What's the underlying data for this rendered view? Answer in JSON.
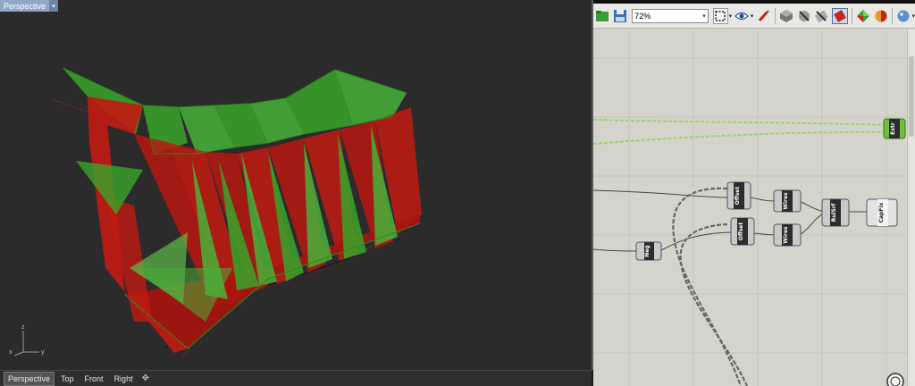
{
  "viewport": {
    "title": "Perspective",
    "tabs": [
      {
        "label": "Perspective",
        "active": true
      },
      {
        "label": "Top",
        "active": false
      },
      {
        "label": "Front",
        "active": false
      },
      {
        "label": "Right",
        "active": false
      }
    ],
    "add_tab_icon": "plus-icon",
    "axes": {
      "x": "x",
      "y": "y",
      "z": "z"
    },
    "colors": {
      "background": "#2b2b2b",
      "red": "#c21a12",
      "green": "#3aa52a"
    }
  },
  "grasshopper": {
    "toolbar": {
      "zoom_value": "72%",
      "icons": [
        "open-file-icon",
        "save-icon",
        "zoom-dropdown",
        "sketch-icon",
        "preview-eye-icon",
        "paint-brush-icon",
        "no-preview-icon",
        "wireframe-preview-icon",
        "shaded-preview-icon",
        "selected-preview-icon",
        "display-mode-icon",
        "bake-icon",
        "sphere-icon"
      ]
    },
    "components": {
      "extr": "Extr",
      "offset_top": "Offset",
      "offset_bottom": "Offset",
      "wires_top": "Wires",
      "wires_bottom": "Wires",
      "rulsrf": "RulSrf",
      "capfix": "CapFix",
      "neg": "Neg"
    },
    "colors": {
      "canvas": "#d4d4cc",
      "wire_selected": "#9fd36a",
      "node_dark": "#2c2c2c",
      "node_body": "#c9c9c9"
    }
  }
}
